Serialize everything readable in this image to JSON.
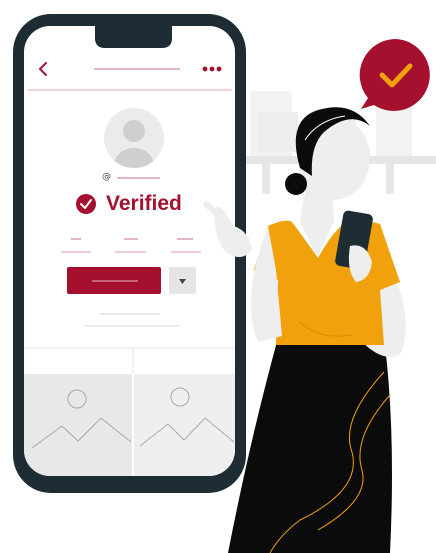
{
  "colors": {
    "brand": "#A4102E",
    "phone_frame": "#1E2D33",
    "screen_bg": "#FFFFFF",
    "placeholder_gray": "#E3E3E3",
    "shirt": "#F1A10B",
    "skirt": "#0B0B0B",
    "skin": "#EEEEEE",
    "check_gold": "#F1A10B"
  },
  "icons": {
    "back": "chevron-left-icon",
    "menu": "more-dots-icon",
    "verified": "check-circle-icon",
    "dropdown": "caret-down-icon",
    "image_placeholder": "image-icon",
    "speech_bubble": "checkmark-speech-bubble-icon"
  },
  "profile": {
    "handle_prefix": "@",
    "status_label": "Verified"
  }
}
